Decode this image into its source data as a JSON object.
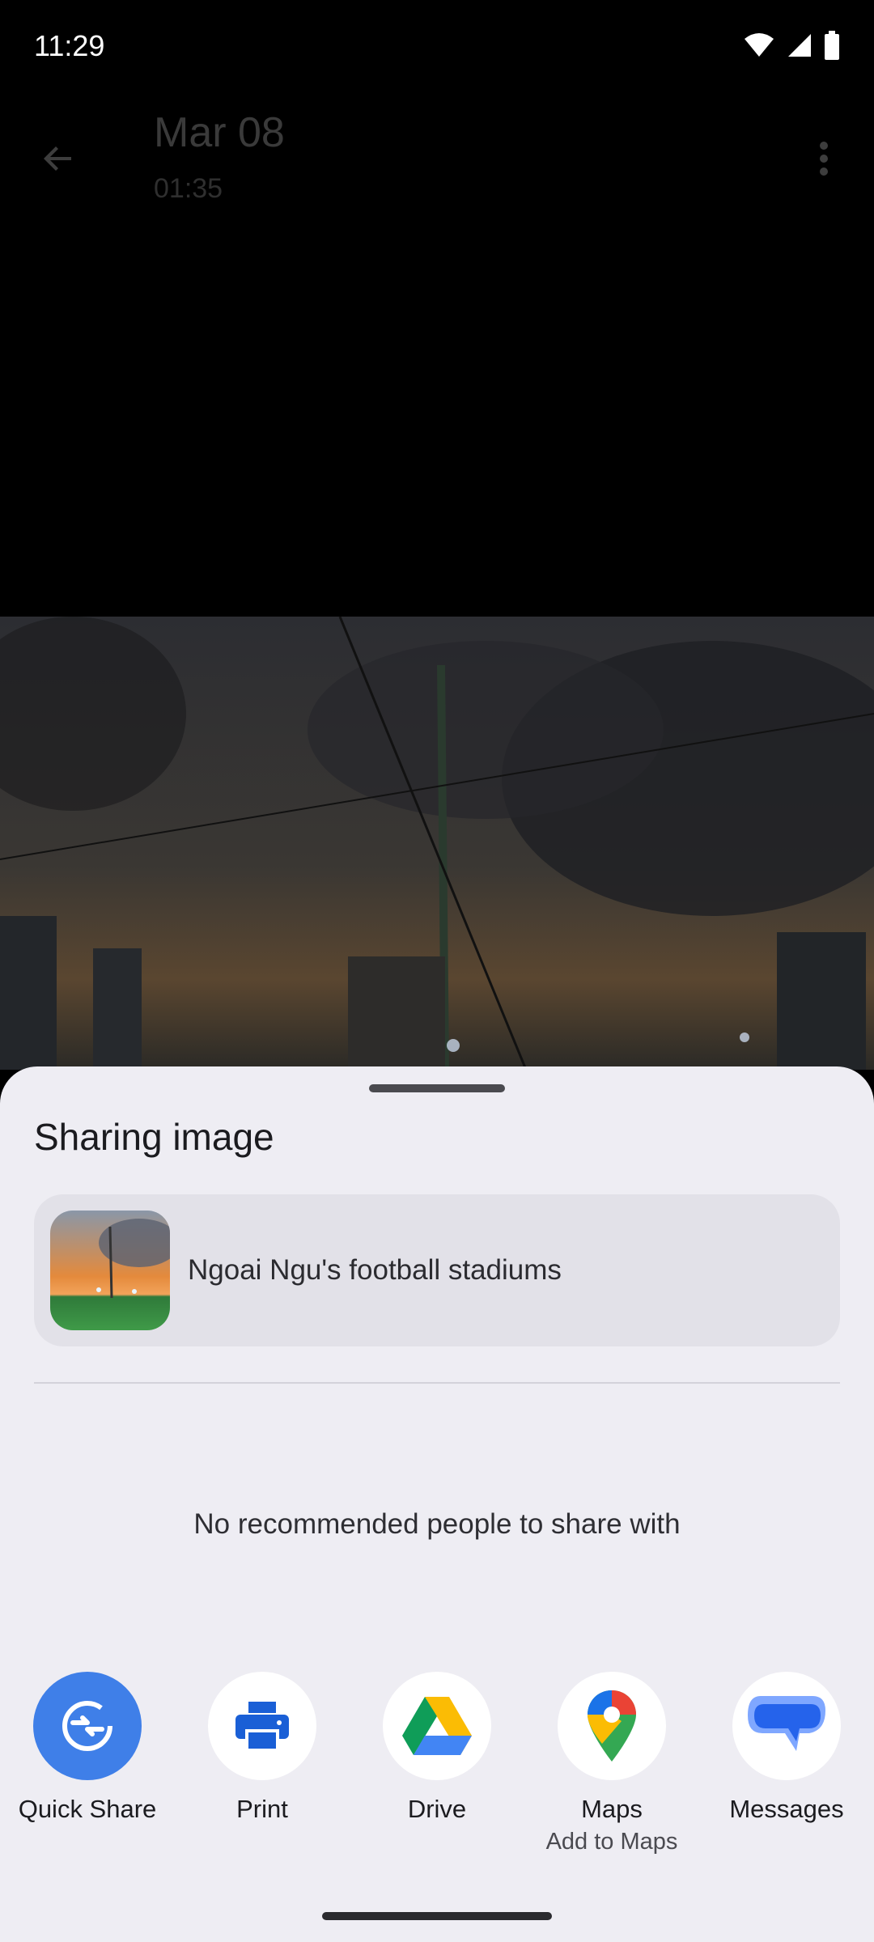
{
  "status_bar": {
    "time": "11:29",
    "icons": [
      "wifi-icon",
      "signal-icon",
      "battery-icon"
    ]
  },
  "app_bar": {
    "date": "Mar 08",
    "time": "01:35",
    "back_icon": "arrow-back-icon",
    "more_icon": "more-vert-icon"
  },
  "share_sheet": {
    "title": "Sharing image",
    "preview_text": "Ngoai Ngu's football stadiums",
    "no_recommendations": "No recommended people to share with",
    "apps": [
      {
        "label": "Quick Share",
        "sublabel": "",
        "icon": "quick-share-icon"
      },
      {
        "label": "Print",
        "sublabel": "",
        "icon": "print-icon"
      },
      {
        "label": "Drive",
        "sublabel": "",
        "icon": "drive-icon"
      },
      {
        "label": "Maps",
        "sublabel": "Add to Maps",
        "icon": "maps-icon"
      },
      {
        "label": "Messages",
        "sublabel": "",
        "icon": "messages-icon"
      }
    ]
  },
  "colors": {
    "sheet_background": "#EEEDF3",
    "quick_share_blue": "#3F7FE8",
    "print_blue": "#1A5FD6",
    "messages_blue": "#2563EB"
  }
}
